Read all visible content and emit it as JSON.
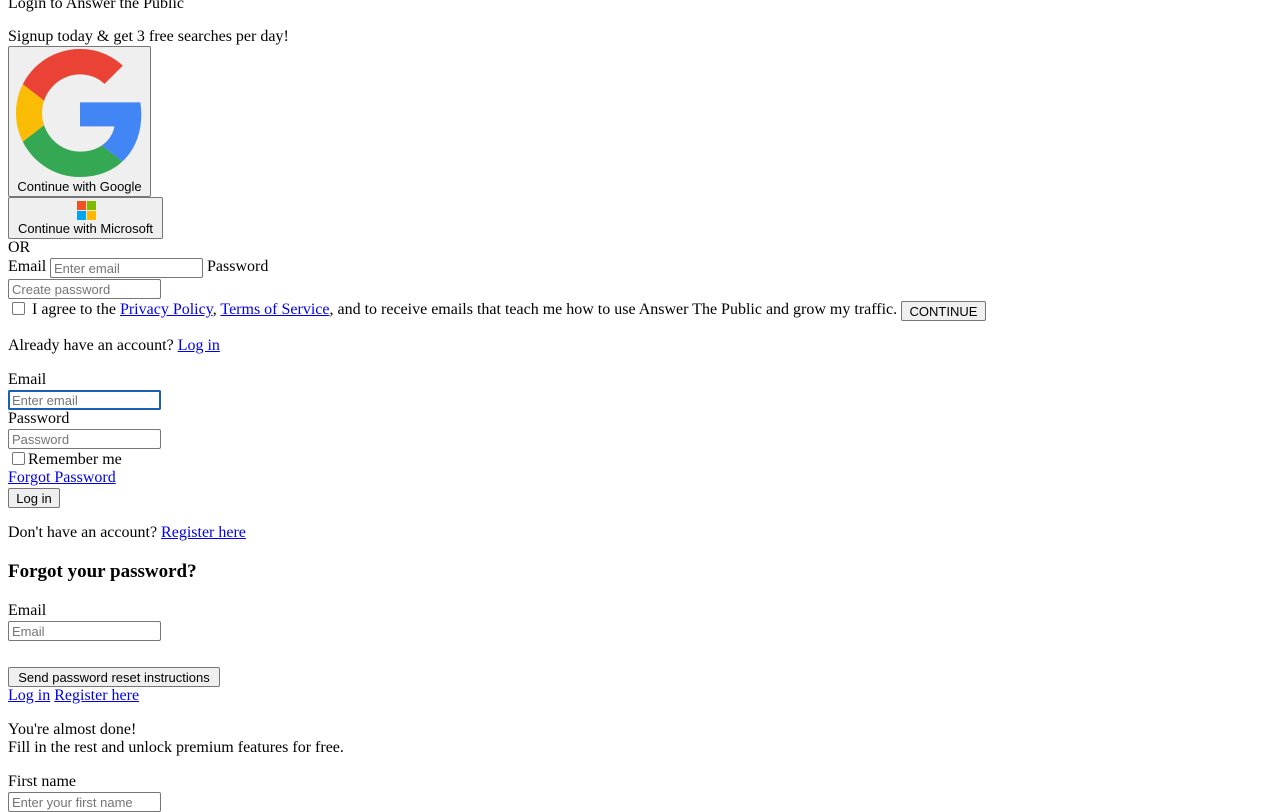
{
  "signup": {
    "title": "Login to Answer the Public",
    "subtitle": "Signup today & get 3 free searches per day!",
    "google_button": "Continue with Google",
    "microsoft_button": "Continue with Microsoft",
    "or_text": "OR",
    "email_label": "Email",
    "email_placeholder": "Enter email",
    "password_label": "Password",
    "password_placeholder": "Create password",
    "agree_prefix": "I agree to the",
    "privacy_link": "Privacy Policy",
    "comma": ",",
    "terms_link": "Terms of Service",
    "agree_suffix": ", and to receive emails that teach me how to use Answer The Public and grow my traffic.",
    "continue_button": "CONTINUE",
    "already_text": "Already have an account?",
    "login_link": "Log in"
  },
  "login": {
    "email_label": "Email",
    "email_placeholder": "Enter email",
    "password_label": "Password",
    "password_placeholder": "Password",
    "remember_label": "Remember me",
    "forgot_link": "Forgot Password",
    "login_button": "Log in",
    "no_account_text": "Don't have an account?",
    "register_link": "Register here"
  },
  "forgot": {
    "heading": "Forgot your password?",
    "email_label": "Email",
    "email_placeholder": "Email",
    "send_button": "Send password reset instructions",
    "login_link": "Log in",
    "register_link": "Register here"
  },
  "finish": {
    "line1": "You're almost done!",
    "line2": "Fill in the rest and unlock premium features for free.",
    "first_name_label": "First name",
    "first_name_placeholder": "Enter your first name"
  },
  "icons": {
    "google": "google-logo-icon",
    "microsoft": "microsoft-logo-icon"
  },
  "colors": {
    "link": "#0000ee",
    "focus": "#1a5fb4",
    "google_red": "#EA4335",
    "google_yellow": "#FBBC05",
    "google_green": "#34A853",
    "google_blue": "#4285F4",
    "ms_red": "#F25022",
    "ms_green": "#7FBA00",
    "ms_blue": "#00A4EF",
    "ms_yellow": "#FFB900"
  }
}
